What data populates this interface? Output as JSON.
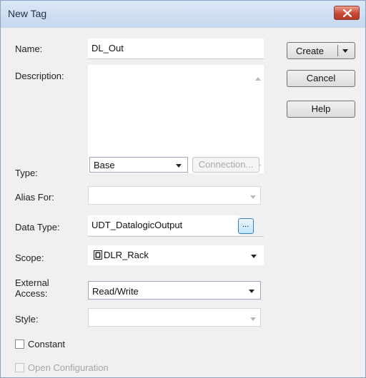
{
  "window": {
    "title": "New Tag",
    "close_icon": "close-icon"
  },
  "fields": {
    "name": {
      "label": "Name:",
      "value": "DL_Out"
    },
    "description": {
      "label": "Description:",
      "value": ""
    },
    "type": {
      "label": "Type:",
      "value": "Base",
      "connection_label": "Connection..."
    },
    "alias_for": {
      "label": "Alias For:",
      "value": ""
    },
    "data_type": {
      "label": "Data Type:",
      "value": "UDT_DatalogicOutput",
      "browse_label": "..."
    },
    "scope": {
      "label": "Scope:",
      "value": "DLR_Rack",
      "icon": "controller-icon"
    },
    "external_access": {
      "label_line1": "External",
      "label_line2": "Access:",
      "value": "Read/Write"
    },
    "style": {
      "label": "Style:",
      "value": ""
    },
    "constant": {
      "label": "Constant",
      "checked": false
    },
    "open_configuration": {
      "label": "Open Configuration",
      "checked": false,
      "enabled": false
    }
  },
  "buttons": {
    "create": "Create",
    "cancel": "Cancel",
    "help": "Help"
  }
}
